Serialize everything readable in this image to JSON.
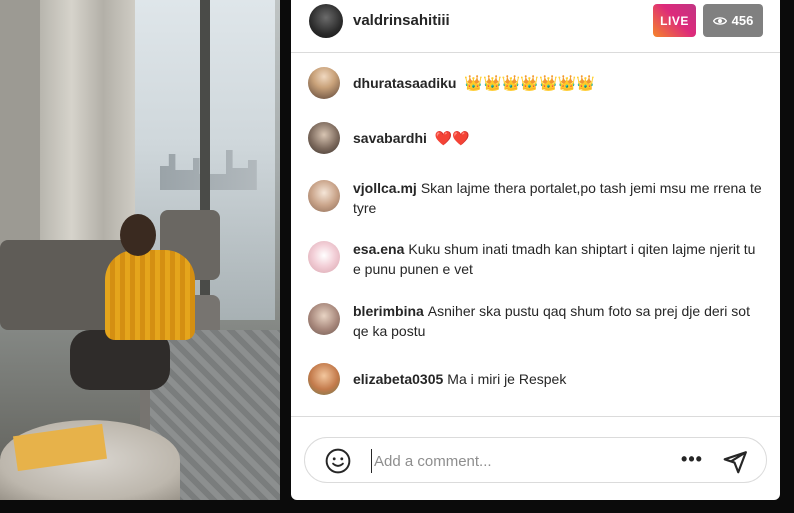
{
  "stream": {
    "host_username": "valdrinsahitiii",
    "live_label": "LIVE",
    "viewer_count": "456"
  },
  "comments": [
    {
      "username": "dhuratasaadiku",
      "text": "👑👑👑👑👑👑👑"
    },
    {
      "username": "savabardhi",
      "text": "❤️❤️"
    },
    {
      "username": "vjollca.mj",
      "text": "Skan lajme thera portalet,po tash jemi msu me rrena te tyre"
    },
    {
      "username": "esa.ena",
      "text": "Kuku shum inati tmadh kan shiptart i qiten lajme njerit tu e punu punen e vet"
    },
    {
      "username": "blerimbina",
      "text": "Asniher ska pustu qaq shum foto sa prej dje deri sot qe ka postu"
    },
    {
      "username": "elizabeta0305",
      "text": "Ma i miri je Respek"
    }
  ],
  "composer": {
    "placeholder": "Add a comment...",
    "more_label": "•••"
  },
  "colors": {
    "live_gradient_start": "#f58529",
    "live_gradient_end": "#c13584",
    "viewer_badge": "#808080"
  },
  "icons": {
    "viewers": "eye-icon",
    "emoji": "smiley-icon",
    "more": "more-horizontal-icon",
    "send": "paper-plane-icon"
  }
}
